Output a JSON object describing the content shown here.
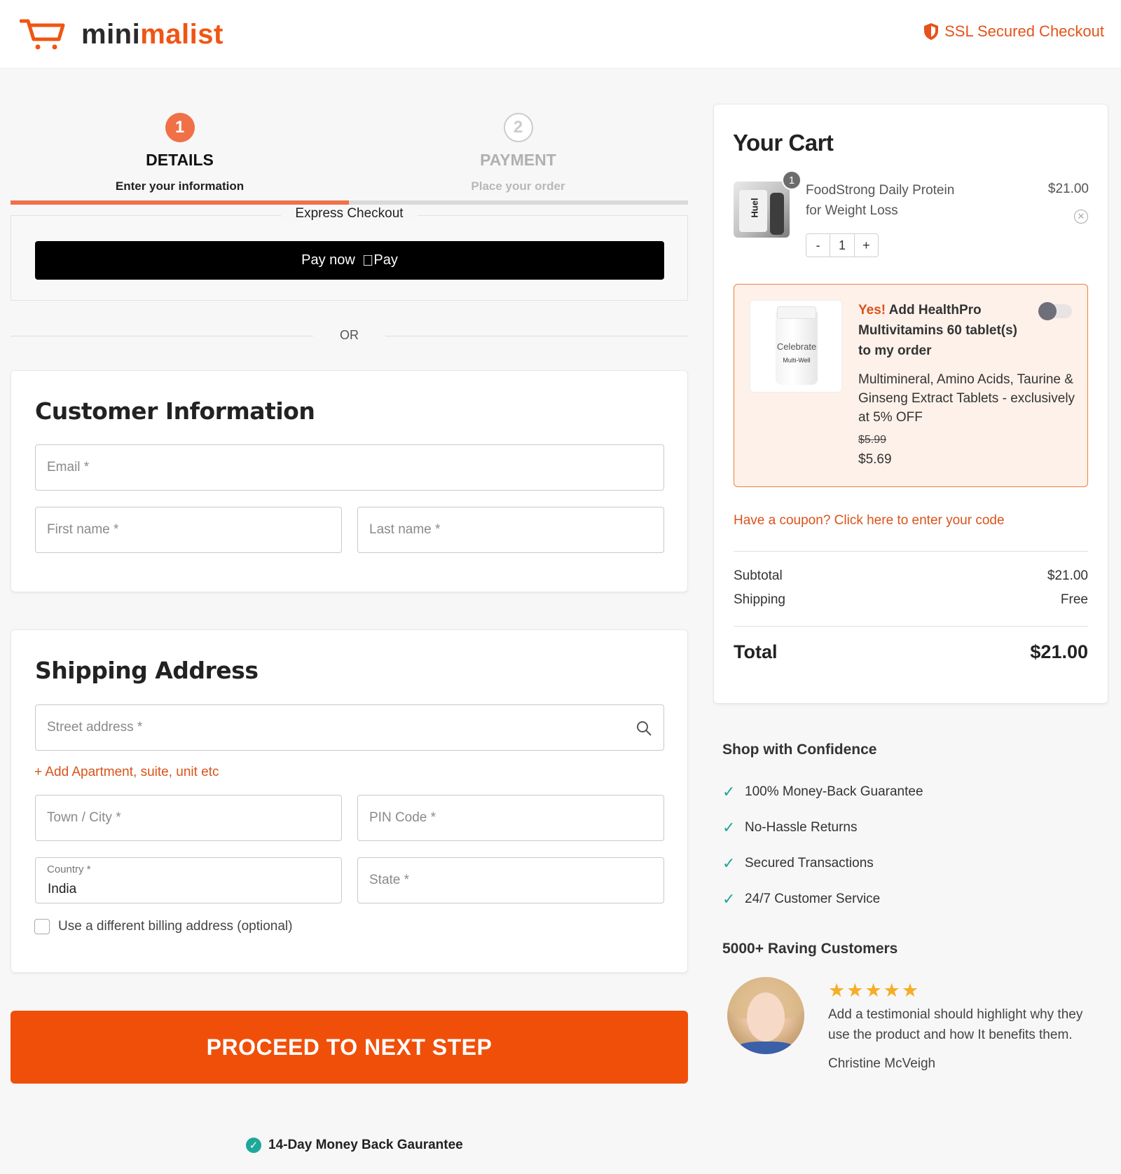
{
  "header": {
    "logo_part1": "mini",
    "logo_part2": "malist",
    "ssl_label": "SSL Secured Checkout",
    "brand_color": "#f05514"
  },
  "steps": [
    {
      "number": "1",
      "title": "DETAILS",
      "subtitle": "Enter your information",
      "active": true
    },
    {
      "number": "2",
      "title": "PAYMENT",
      "subtitle": "Place your order",
      "active": false
    }
  ],
  "progress": {
    "current_step": 1,
    "total_steps": 2
  },
  "express": {
    "label": "Express Checkout",
    "pay_button_text": "Pay now",
    "pay_brand": "Pay"
  },
  "divider_text": "OR",
  "customer_info": {
    "title": "Customer Information",
    "email_placeholder": "Email *",
    "first_name_placeholder": "First name *",
    "last_name_placeholder": "Last name *"
  },
  "shipping": {
    "title": "Shipping Address",
    "street_placeholder": "Street address *",
    "add_apartment": "+ Add Apartment, suite, unit etc",
    "city_placeholder": "Town / City *",
    "pin_placeholder": "PIN Code *",
    "country_label": "Country *",
    "country_value": "India",
    "state_placeholder": "State *",
    "billing_checkbox": "Use a different billing address (optional)"
  },
  "proceed_button": "PROCEED TO NEXT STEP",
  "guarantee": "14-Day Money Back Gaurantee",
  "cart": {
    "title": "Your Cart",
    "item": {
      "name": "FoodStrong Daily Protein for Weight Loss",
      "price": "$21.00",
      "quantity": "1",
      "badge": "1",
      "minus": "-",
      "plus": "+"
    },
    "upsell": {
      "yes": "Yes!",
      "headline": " Add HealthPro Multivitamins 60 tablet(s) to my order",
      "description": "Multimineral, Amino Acids, Taurine & Ginseng Extract Tablets - exclusively at 5% OFF",
      "old_price": "$5.99",
      "new_price": "$5.69",
      "enabled": false
    },
    "coupon_link": "Have a coupon? Click here to enter your code",
    "subtotal_label": "Subtotal",
    "subtotal_value": "$21.00",
    "shipping_label": "Shipping",
    "shipping_value": "Free",
    "total_label": "Total",
    "total_value": "$21.00"
  },
  "confidence": {
    "title": "Shop with Confidence",
    "items": [
      "100% Money-Back Guarantee",
      "No-Hassle Returns",
      "Secured Transactions",
      "24/7 Customer Service"
    ]
  },
  "testimonial": {
    "section_title": "5000+ Raving Customers",
    "rating": 5,
    "text": "Add a testimonial should highlight why they use the product and how It benefits them.",
    "author": "Christine McVeigh"
  }
}
